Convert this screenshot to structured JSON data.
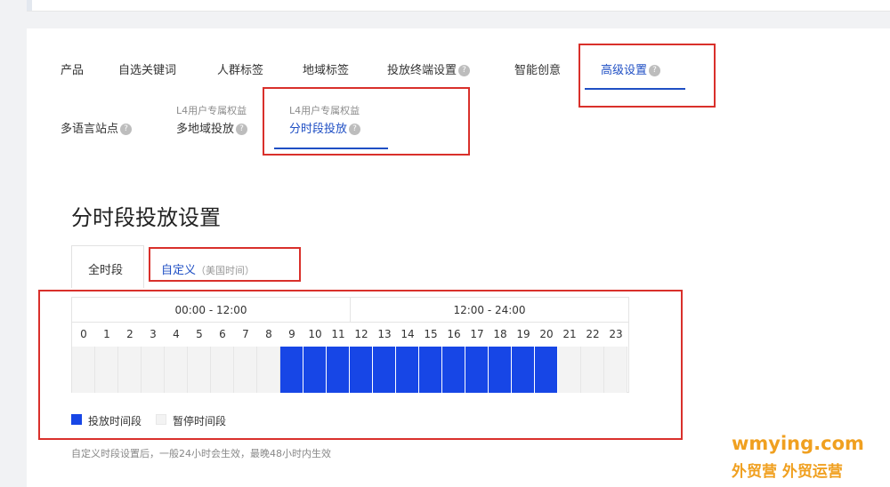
{
  "tabs_row1": [
    {
      "label": "产品",
      "help": false,
      "active": false
    },
    {
      "label": "自选关键词",
      "help": false,
      "active": false
    },
    {
      "label": "人群标签",
      "help": false,
      "active": false
    },
    {
      "label": "地域标签",
      "help": false,
      "active": false
    },
    {
      "label": "投放终端设置",
      "help": true,
      "active": false
    },
    {
      "label": "智能创意",
      "help": false,
      "active": false
    },
    {
      "label": "高级设置",
      "help": true,
      "active": true
    }
  ],
  "tabs_row2": [
    {
      "label": "多语言站点",
      "sublabel": "",
      "help": true,
      "active": false
    },
    {
      "label": "多地域投放",
      "sublabel": "L4用户专属权益",
      "help": true,
      "active": false
    },
    {
      "label": "分时段投放",
      "sublabel": "L4用户专属权益",
      "help": true,
      "active": true
    }
  ],
  "help_glyph": "?",
  "section_title": "分时段投放设置",
  "mode_tabs": {
    "all": "全时段",
    "custom": "自定义",
    "custom_hint": "（美国时间）",
    "selected": "custom"
  },
  "schedule": {
    "half_labels": [
      "00:00 - 12:00",
      "12:00 - 24:00"
    ],
    "hours": [
      "0",
      "1",
      "2",
      "3",
      "4",
      "5",
      "6",
      "7",
      "8",
      "9",
      "10",
      "11",
      "12",
      "13",
      "14",
      "15",
      "16",
      "17",
      "18",
      "19",
      "20",
      "21",
      "22",
      "23"
    ],
    "active_hours": [
      9,
      10,
      11,
      12,
      13,
      14,
      15,
      16,
      17,
      18,
      19,
      20
    ]
  },
  "legend": {
    "active_label": "投放时间段",
    "paused_label": "暂停时间段"
  },
  "colors": {
    "active": "#1746e6",
    "paused": "#f3f3f3",
    "accent": "#1f4fc4",
    "annotation": "#d9302b",
    "watermark": "#f0a020"
  },
  "note": "自定义时段设置后，一般24小时会生效，最晚48小时内生效",
  "watermark": {
    "line1": "wmying.com",
    "line2": "外贸营 外贸运营"
  }
}
